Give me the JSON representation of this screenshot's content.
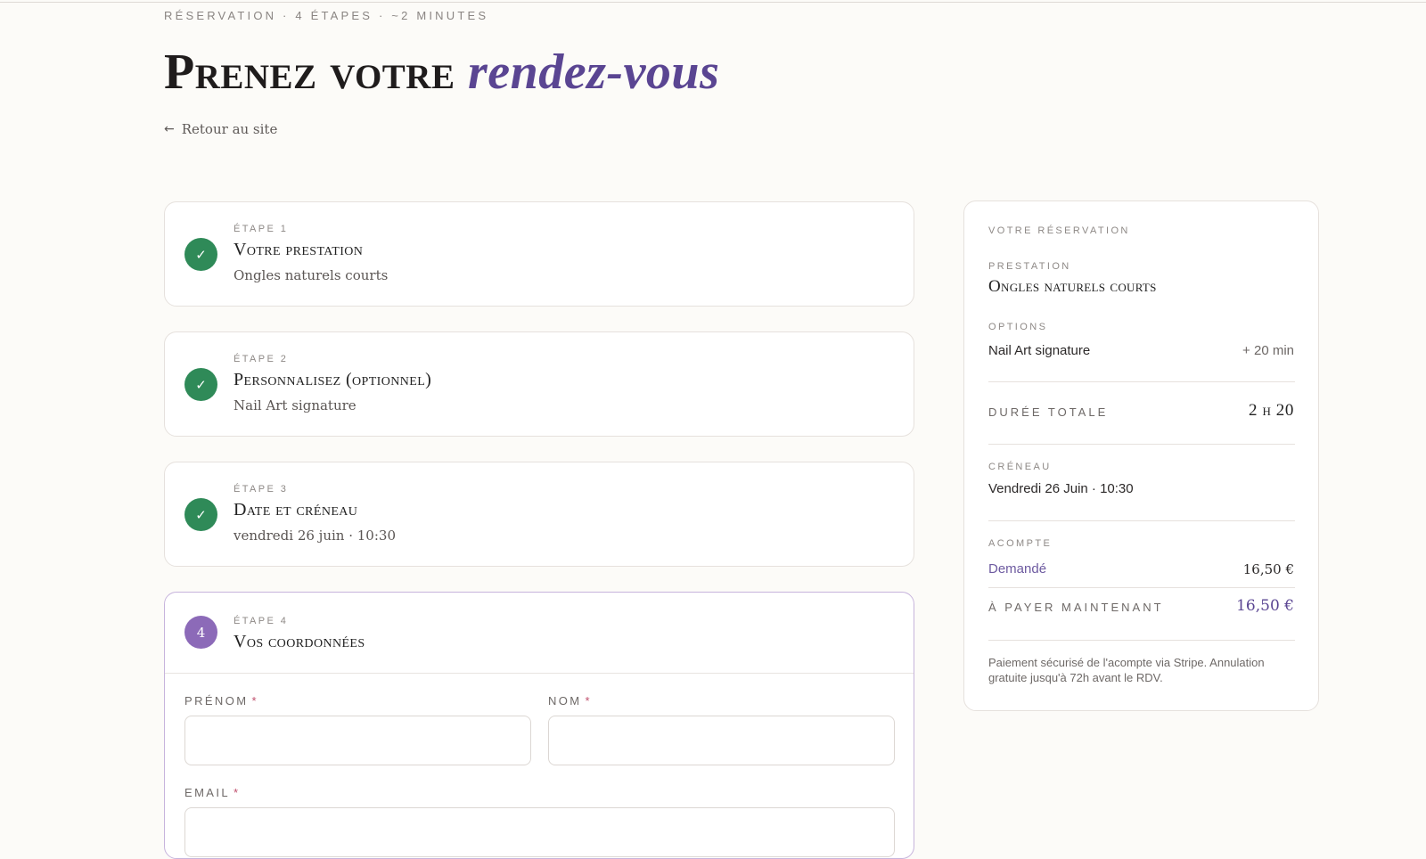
{
  "header": {
    "eyebrow": "Réservation · 4 étapes · ~2 minutes",
    "title_plain": "Prenez votre",
    "title_accent": "rendez-vous",
    "back_label": "Retour au site"
  },
  "steps": [
    {
      "label": "Étape 1",
      "title": "Votre prestation",
      "summary": "Ongles naturels courts",
      "status": "done"
    },
    {
      "label": "Étape 2",
      "title": "Personnalisez (optionnel)",
      "summary": "Nail Art signature",
      "status": "done"
    },
    {
      "label": "Étape 3",
      "title": "Date et créneau",
      "summary": "vendredi 26 juin · 10:30",
      "status": "done"
    },
    {
      "label": "Étape 4",
      "title": "Vos coordonnées",
      "number": "4",
      "status": "active"
    }
  ],
  "form": {
    "prenom_label": "Prénom",
    "nom_label": "Nom",
    "email_label": "Email",
    "required_mark": "*",
    "prenom_value": "",
    "nom_value": "",
    "email_value": ""
  },
  "summary": {
    "heading": "Votre réservation",
    "prestation_label": "Prestation",
    "prestation_value": "Ongles naturels courts",
    "options_label": "Options",
    "option_name": "Nail Art signature",
    "option_duration": "+ 20 min",
    "duration_label": "Durée totale",
    "duration_value": "2 h 20",
    "slot_label": "Créneau",
    "slot_value": "Vendredi 26 Juin · 10:30",
    "deposit_label": "Acompte",
    "requested_label": "Demandé",
    "requested_value": "16,50 €",
    "pay_now_label": "À payer maintenant",
    "pay_now_value": "16,50 €",
    "note": "Paiement sécurisé de l'acompte via Stripe. Annulation gratuite jusqu'à 72h avant le RDV."
  },
  "colors": {
    "accent": "#5a4592",
    "success": "#2f8a58",
    "active_step": "#8c6ab8",
    "background": "#fcfbf8"
  },
  "icons": {
    "check": "check-icon",
    "back": "arrow-left-icon"
  }
}
